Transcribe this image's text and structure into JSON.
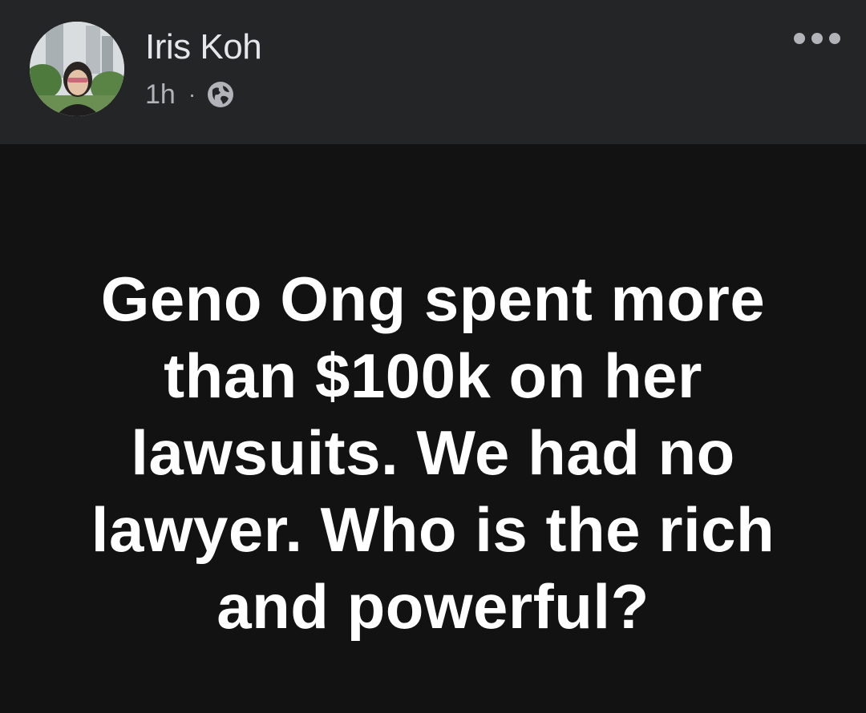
{
  "post": {
    "author_name": "Iris Koh",
    "timestamp": "1h",
    "separator": "·",
    "visibility_icon": "globe-icon",
    "menu_icon": "more-options-icon",
    "text": "Geno Ong spent more than $100k on her lawsuits. We had no lawyer. Who is the rich and powerful?"
  },
  "colors": {
    "header_background": "#242526",
    "body_background": "#121212",
    "primary_text": "#e4e6eb",
    "secondary_text": "#b0b3b8",
    "post_text": "#ffffff"
  }
}
